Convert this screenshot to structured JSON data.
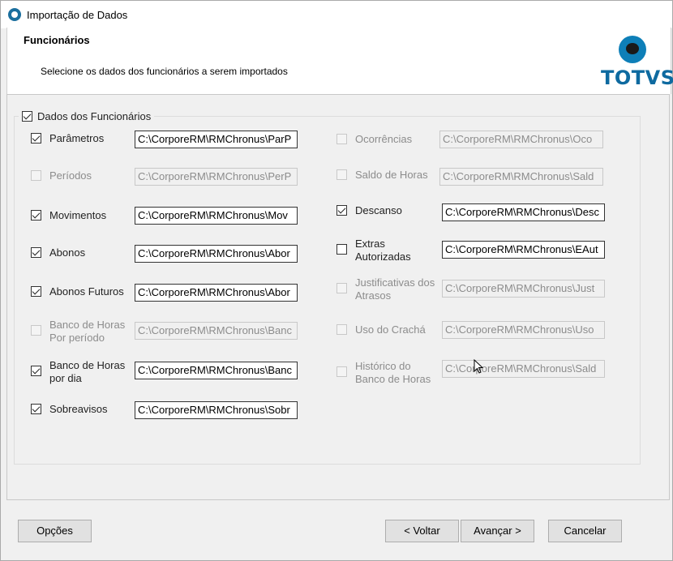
{
  "window": {
    "title": "Importação de Dados"
  },
  "header": {
    "title": "Funcionários",
    "subtitle": "Selecione os dados dos funcionários a serem importados",
    "logo_text": "TOTVS"
  },
  "group": {
    "label": "Dados dos Funcionários",
    "checked": true
  },
  "left_items": [
    {
      "label": "Parâmetros",
      "checked": true,
      "enabled": true,
      "path": "C:\\CorporeRM\\RMChronus\\ParP"
    },
    {
      "label": "Períodos",
      "checked": false,
      "enabled": false,
      "path": "C:\\CorporeRM\\RMChronus\\PerP"
    },
    {
      "label": "Movimentos",
      "checked": true,
      "enabled": true,
      "path": "C:\\CorporeRM\\RMChronus\\Mov"
    },
    {
      "label": "Abonos",
      "checked": true,
      "enabled": true,
      "path": "C:\\CorporeRM\\RMChronus\\Abor"
    },
    {
      "label": "Abonos Futuros",
      "checked": true,
      "enabled": true,
      "path": "C:\\CorporeRM\\RMChronus\\Abor"
    },
    {
      "label": "Banco de Horas Por período",
      "checked": false,
      "enabled": false,
      "path": "C:\\CorporeRM\\RMChronus\\Banc"
    },
    {
      "label": "Banco de Horas por dia",
      "checked": true,
      "enabled": true,
      "path": "C:\\CorporeRM\\RMChronus\\Banc"
    },
    {
      "label": "Sobreavisos",
      "checked": true,
      "enabled": true,
      "path": "C:\\CorporeRM\\RMChronus\\Sobr"
    }
  ],
  "right_items": [
    {
      "label": "Ocorrências",
      "checked": false,
      "enabled": false,
      "path": "C:\\CorporeRM\\RMChronus\\Oco"
    },
    {
      "label": "Saldo de Horas",
      "checked": false,
      "enabled": false,
      "path": "C:\\CorporeRM\\RMChronus\\Sald"
    },
    {
      "label": "Descanso",
      "checked": true,
      "enabled": true,
      "path": "C:\\CorporeRM\\RMChronus\\Desc"
    },
    {
      "label": "Extras Autorizadas",
      "checked": false,
      "enabled": true,
      "path": "C:\\CorporeRM\\RMChronus\\EAut"
    },
    {
      "label": "Justificativas dos Atrasos",
      "checked": false,
      "enabled": false,
      "path": "C:\\CorporeRM\\RMChronus\\Just"
    },
    {
      "label": "Uso do Crachá",
      "checked": false,
      "enabled": false,
      "path": "C:\\CorporeRM\\RMChronus\\Uso"
    },
    {
      "label": "Histórico do Banco de Horas",
      "checked": false,
      "enabled": false,
      "path": "C:\\CorporeRM\\RMChronus\\Sald"
    }
  ],
  "buttons": {
    "options": "Opções",
    "back": "< Voltar",
    "next": "Avançar >",
    "cancel": "Cancelar"
  },
  "colors": {
    "logo_blue": "#0e6aa0",
    "window_bg": "#f0f0f0"
  }
}
